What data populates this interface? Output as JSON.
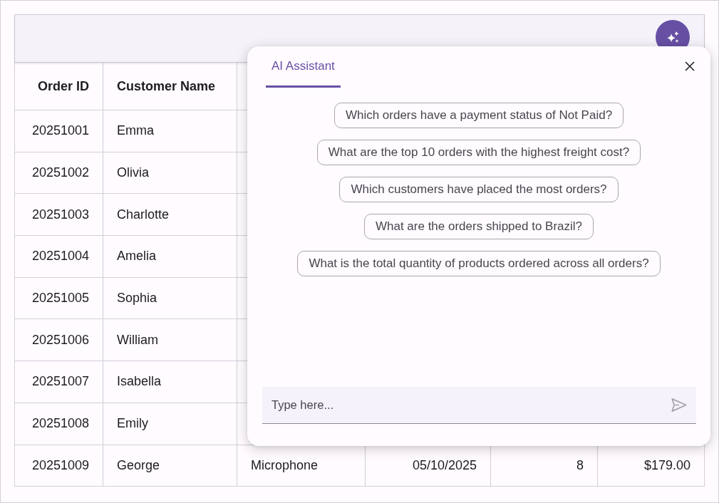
{
  "grid": {
    "columns": [
      "Order ID",
      "Customer Name"
    ],
    "rows": [
      {
        "cells": [
          "20251001",
          "Emma"
        ]
      },
      {
        "cells": [
          "20251002",
          "Olivia"
        ]
      },
      {
        "cells": [
          "20251003",
          "Charlotte"
        ]
      },
      {
        "cells": [
          "20251004",
          "Amelia"
        ]
      },
      {
        "cells": [
          "20251005",
          "Sophia"
        ]
      },
      {
        "cells": [
          "20251006",
          "William"
        ]
      },
      {
        "cells": [
          "20251007",
          "Isabella"
        ]
      },
      {
        "cells": [
          "20251008",
          "Emily"
        ]
      },
      {
        "cells": [
          "20251009",
          "George",
          "Microphone",
          "05/10/2025",
          "8",
          "$179.00"
        ]
      }
    ]
  },
  "assistant": {
    "tabs": [
      {
        "label": "AI Assistant",
        "selected": true
      }
    ],
    "suggestions": [
      "Which orders have a payment status of Not Paid?",
      "What are the top 10 orders with the highest freight cost?",
      "Which customers have placed the most orders?",
      "What are the orders shipped to Brazil?",
      "What is the total quantity of products ordered across all orders?"
    ],
    "input": {
      "placeholder": "Type here..."
    }
  }
}
